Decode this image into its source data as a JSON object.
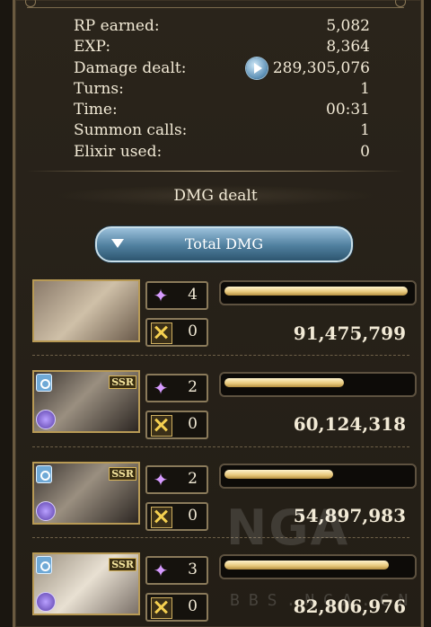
{
  "stats": [
    {
      "label": "RP earned:",
      "value": "5,082"
    },
    {
      "label": "EXP:",
      "value": "8,364"
    },
    {
      "label": "Damage dealt:",
      "value": "289,305,076",
      "icon": "play-icon"
    },
    {
      "label": "Turns:",
      "value": "1"
    },
    {
      "label": "Time:",
      "value": "00:31"
    },
    {
      "label": "Summon calls:",
      "value": "1"
    },
    {
      "label": "Elixir used:",
      "value": "0"
    }
  ],
  "section_title": "DMG dealt",
  "total_button": {
    "label": "Total DMG"
  },
  "members": [
    {
      "skills": "4",
      "charge_attacks": "0",
      "damage": "91,475,799",
      "fill": 0.98,
      "rarity": ""
    },
    {
      "skills": "2",
      "charge_attacks": "0",
      "damage": "60,124,318",
      "fill": 0.64,
      "rarity": "SSR"
    },
    {
      "skills": "2",
      "charge_attacks": "0",
      "damage": "54,897,983",
      "fill": 0.58,
      "rarity": "SSR"
    },
    {
      "skills": "3",
      "charge_attacks": "0",
      "damage": "82,806,976",
      "fill": 0.88,
      "rarity": "SSR"
    }
  ],
  "watermark": {
    "logo": "NGA",
    "site": "BBS.NGA.CN"
  }
}
